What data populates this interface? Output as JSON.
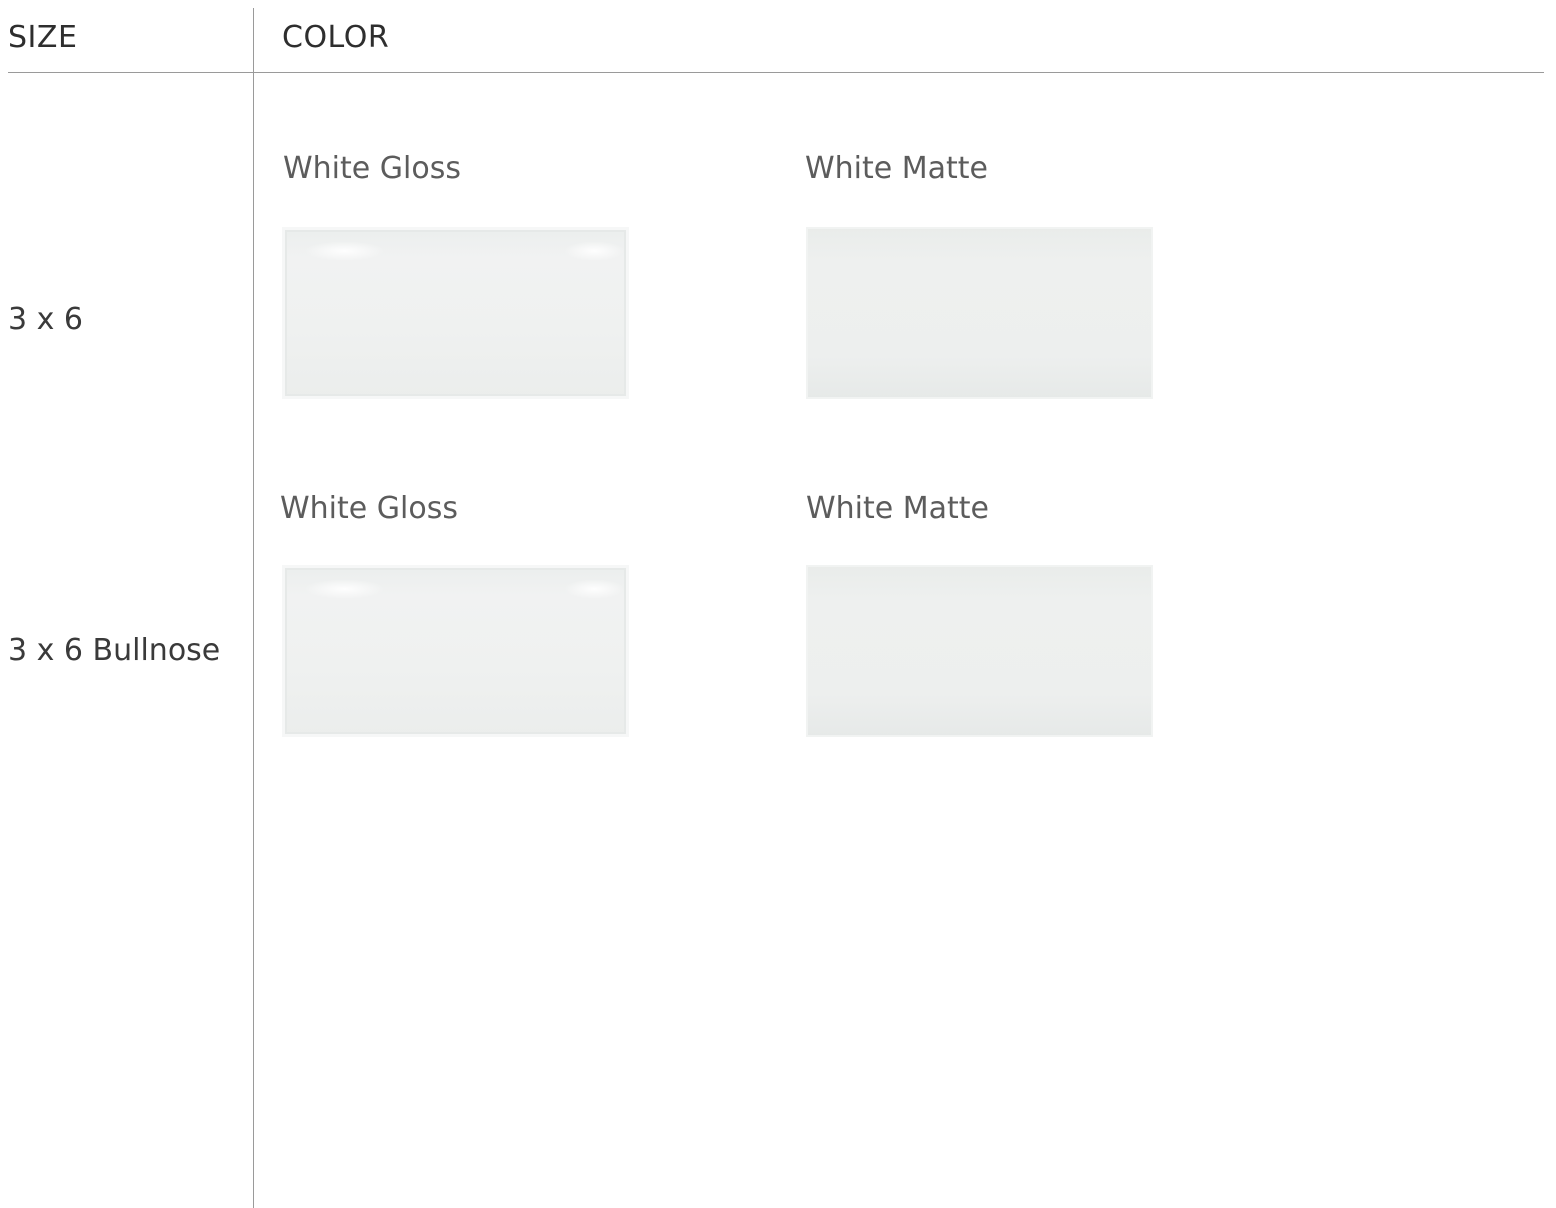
{
  "header": {
    "size_label": "SIZE",
    "color_label": "COLOR"
  },
  "rows": [
    {
      "size": "3 x 6",
      "swatches": [
        {
          "name": "White Gloss",
          "finish": "gloss"
        },
        {
          "name": "White Matte",
          "finish": "matte"
        }
      ]
    },
    {
      "size": "3 x 6 Bullnose",
      "swatches": [
        {
          "name": "White Gloss",
          "finish": "gloss"
        },
        {
          "name": "White Matte",
          "finish": "matte"
        }
      ]
    }
  ],
  "colors": {
    "divider": "#9a9a9a",
    "text": "#333333",
    "swatch_label": "#5c5c5c"
  }
}
